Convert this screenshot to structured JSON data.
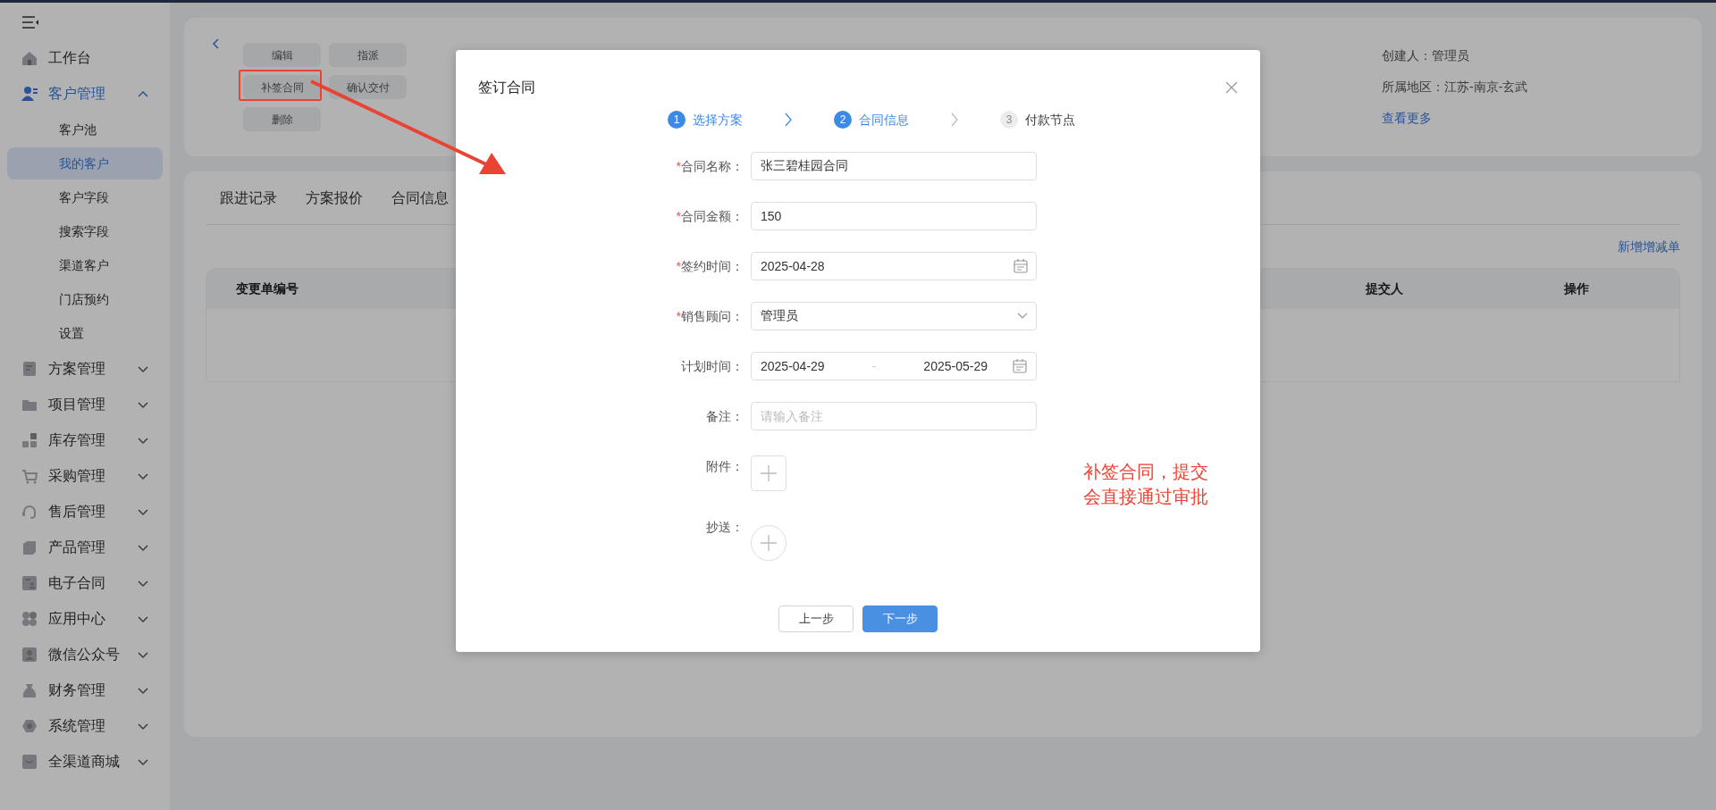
{
  "sidebar": {
    "items": [
      {
        "label": "工作台",
        "selected": false
      },
      {
        "label": "客户管理",
        "selected": true,
        "expanded": true,
        "children": [
          {
            "label": "客户池",
            "selected": false
          },
          {
            "label": "我的客户",
            "selected": true
          },
          {
            "label": "客户字段",
            "selected": false
          },
          {
            "label": "搜索字段",
            "selected": false
          },
          {
            "label": "渠道客户",
            "selected": false
          },
          {
            "label": "门店预约",
            "selected": false
          },
          {
            "label": "设置",
            "selected": false
          }
        ]
      },
      {
        "label": "方案管理",
        "selected": false,
        "expanded": false
      },
      {
        "label": "项目管理",
        "selected": false,
        "expanded": false
      },
      {
        "label": "库存管理",
        "selected": false,
        "expanded": false
      },
      {
        "label": "采购管理",
        "selected": false,
        "expanded": false
      },
      {
        "label": "售后管理",
        "selected": false,
        "expanded": false
      },
      {
        "label": "产品管理",
        "selected": false,
        "expanded": false
      },
      {
        "label": "电子合同",
        "selected": false,
        "expanded": false
      },
      {
        "label": "应用中心",
        "selected": false,
        "expanded": false
      },
      {
        "label": "微信公众号",
        "selected": false,
        "expanded": false
      },
      {
        "label": "财务管理",
        "selected": false,
        "expanded": false
      },
      {
        "label": "系统管理",
        "selected": false,
        "expanded": false
      },
      {
        "label": "全渠道商城",
        "selected": false,
        "expanded": false
      }
    ]
  },
  "detail": {
    "actions": [
      {
        "label": "编辑"
      },
      {
        "label": "指派"
      },
      {
        "label": "补签合同"
      },
      {
        "label": "确认交付"
      },
      {
        "label": "删除"
      }
    ],
    "info": [
      "创建人：管理员",
      "所属地区：江苏-南京-玄武"
    ],
    "more_link": "查看更多"
  },
  "records": {
    "tabs": [
      "跟进记录",
      "方案报价",
      "合同信息"
    ],
    "add_link": "新增增减单",
    "table": {
      "columns": [
        "变更单编号",
        "提交人",
        "操作"
      ]
    }
  },
  "dialog": {
    "title": "签订合同",
    "steps": [
      {
        "number": "1",
        "label": "选择方案",
        "active": true
      },
      {
        "number": "2",
        "label": "合同信息",
        "active": true
      },
      {
        "number": "3",
        "label": "付款节点",
        "active": false
      }
    ],
    "fields": [
      {
        "kind": "text",
        "required_mark": "*",
        "label": "合同名称：",
        "value": "张三碧桂园合同"
      },
      {
        "kind": "text",
        "required_mark": "*",
        "label": "合同金额：",
        "value": "150"
      },
      {
        "kind": "date",
        "required_mark": "*",
        "label": "签约时间：",
        "value": "2025-04-28"
      },
      {
        "kind": "select",
        "required_mark": "*",
        "label": "销售顾问：",
        "value": "管理员"
      },
      {
        "kind": "daterange",
        "label": "计划时间：",
        "start": "2025-04-29",
        "separator": "-",
        "end": "2025-05-29"
      },
      {
        "kind": "text",
        "label": "备注：",
        "placeholder": "请输入备注"
      },
      {
        "kind": "upload",
        "label": "附件："
      },
      {
        "kind": "picker",
        "label": "抄送："
      }
    ],
    "buttons": [
      {
        "label": "上一步",
        "kind": "default"
      },
      {
        "label": "下一步",
        "kind": "primary"
      }
    ]
  },
  "annotation": {
    "lines": [
      "补签合同，提交",
      "会直接通过审批"
    ]
  }
}
